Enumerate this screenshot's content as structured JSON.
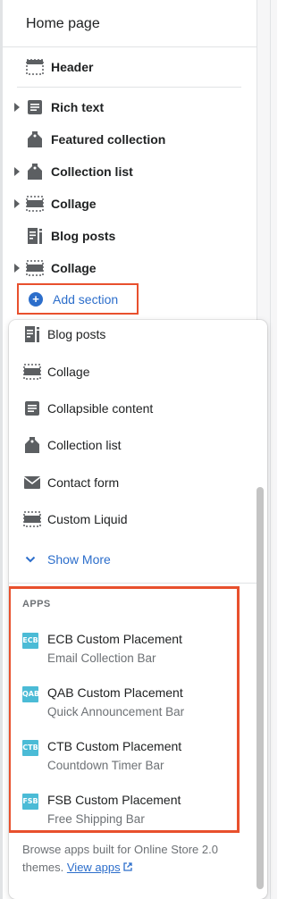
{
  "page_title": "Home page",
  "sections": [
    {
      "label": "Header",
      "icon": "header-icon",
      "caret": false
    },
    {
      "label": "Rich text",
      "icon": "text-icon",
      "caret": true
    },
    {
      "label": "Featured collection",
      "icon": "tag-icon",
      "caret": false
    },
    {
      "label": "Collection list",
      "icon": "tag-icon",
      "caret": true
    },
    {
      "label": "Collage",
      "icon": "collage-icon",
      "caret": true
    },
    {
      "label": "Blog posts",
      "icon": "blog-icon",
      "caret": false
    },
    {
      "label": "Collage",
      "icon": "collage-icon",
      "caret": true
    }
  ],
  "add_section_label": "Add section",
  "popover": {
    "items": [
      {
        "label": "Blog posts",
        "icon": "blog-icon"
      },
      {
        "label": "Collage",
        "icon": "collage-icon"
      },
      {
        "label": "Collapsible content",
        "icon": "text-icon"
      },
      {
        "label": "Collection list",
        "icon": "tag-icon"
      },
      {
        "label": "Contact form",
        "icon": "envelope-icon"
      },
      {
        "label": "Custom Liquid",
        "icon": "collage-icon"
      }
    ],
    "show_more": "Show More",
    "apps_heading": "APPS",
    "apps": [
      {
        "logo": "ECB",
        "name": "ECB Custom Placement",
        "desc": "Email Collection Bar"
      },
      {
        "logo": "QAB",
        "name": "QAB Custom Placement",
        "desc": "Quick Announcement Bar"
      },
      {
        "logo": "CTB",
        "name": "CTB Custom Placement",
        "desc": "Countdown Timer Bar"
      },
      {
        "logo": "FSB",
        "name": "FSB Custom Placement",
        "desc": "Free Shipping Bar"
      }
    ],
    "footer_text": "Browse apps built for Online Store 2.0 themes.",
    "footer_link": "View apps"
  },
  "colors": {
    "accent": "#2c6ecb",
    "highlight": "#e8502d",
    "app_logo": "#4bbbd6"
  }
}
